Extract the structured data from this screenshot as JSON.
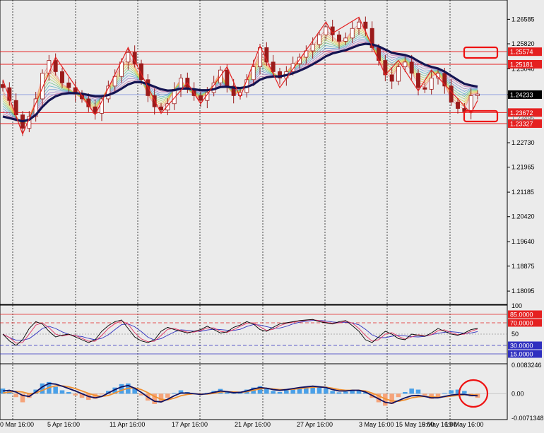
{
  "chart_data": {
    "type": "line",
    "main": {
      "y_ticks": [
        "1.26585",
        "1.25820",
        "1.25040",
        "1.24233",
        "1.22730",
        "1.21965",
        "1.21185",
        "1.20420",
        "1.19640",
        "1.18875",
        "1.18095"
      ],
      "ylim": [
        1.177,
        1.271
      ],
      "price_labels": [
        {
          "text": "1.25574",
          "value": 1.25574,
          "color": "#e52020"
        },
        {
          "text": "1.25181",
          "value": 1.25181,
          "color": "#e52020"
        },
        {
          "text": "1.24233",
          "value": 1.24233,
          "color": "#000000"
        },
        {
          "text": "1.23672",
          "value": 1.23672,
          "color": "#e52020"
        },
        {
          "text": "1.23327",
          "value": 1.23327,
          "color": "#e52020"
        }
      ],
      "hidden_tick": "1.23495",
      "levels": [
        1.25574,
        1.25181,
        1.23672,
        1.23327
      ],
      "current_price": 1.24233,
      "close_series": [
        1.2445,
        1.2405,
        1.236,
        1.2318,
        1.2355,
        1.241,
        1.249,
        1.253,
        1.2495,
        1.246,
        1.2445,
        1.2425,
        1.241,
        1.2385,
        1.2365,
        1.241,
        1.245,
        1.248,
        1.2525,
        1.2555,
        1.252,
        1.247,
        1.242,
        1.2385,
        1.2375,
        1.2395,
        1.244,
        1.2475,
        1.244,
        1.242,
        1.2405,
        1.243,
        1.246,
        1.25,
        1.245,
        1.242,
        1.243,
        1.247,
        1.251,
        1.257,
        1.2525,
        1.2495,
        1.2475,
        1.2495,
        1.252,
        1.254,
        1.256,
        1.258,
        1.261,
        1.2635,
        1.261,
        1.259,
        1.26,
        1.263,
        1.265,
        1.263,
        1.257,
        1.253,
        1.2485,
        1.2465,
        1.251,
        1.2525,
        1.249,
        1.2445,
        1.244,
        1.2475,
        1.249,
        1.245,
        1.24,
        1.238,
        1.237,
        1.242,
        1.2425
      ],
      "ema_series": [
        1.2355,
        1.235,
        1.2345,
        1.234,
        1.2345,
        1.236,
        1.2385,
        1.2405,
        1.2418,
        1.2425,
        1.2428,
        1.2428,
        1.2426,
        1.2422,
        1.2418,
        1.2418,
        1.2422,
        1.243,
        1.2442,
        1.2455,
        1.2462,
        1.2462,
        1.2456,
        1.2448,
        1.244,
        1.2436,
        1.2437,
        1.2442,
        1.2442,
        1.244,
        1.2437,
        1.2437,
        1.244,
        1.2447,
        1.2448,
        1.2445,
        1.2444,
        1.2447,
        1.2455,
        1.247,
        1.2477,
        1.248,
        1.248,
        1.2484,
        1.249,
        1.2498,
        1.2507,
        1.2518,
        1.253,
        1.2543,
        1.2552,
        1.2557,
        1.2562,
        1.257,
        1.2578,
        1.2582,
        1.258,
        1.2574,
        1.2564,
        1.2554,
        1.255,
        1.2547,
        1.254,
        1.2528,
        1.2517,
        1.251,
        1.2505,
        1.2495,
        1.2482,
        1.2469,
        1.2457,
        1.2452,
        1.2448
      ],
      "zigzag": [
        [
          0,
          1.247
        ],
        [
          3,
          1.23
        ],
        [
          8,
          1.254
        ],
        [
          14,
          1.236
        ],
        [
          19,
          1.257
        ],
        [
          24,
          1.2365
        ],
        [
          28,
          1.246
        ],
        [
          30,
          1.2395
        ],
        [
          34,
          1.251
        ],
        [
          36,
          1.2415
        ],
        [
          39,
          1.2575
        ],
        [
          42,
          1.2445
        ],
        [
          49,
          1.265
        ],
        [
          50,
          1.2615
        ],
        [
          54,
          1.2665
        ],
        [
          58,
          1.2485
        ],
        [
          60,
          1.253
        ],
        [
          63,
          1.2435
        ],
        [
          65,
          1.25
        ],
        [
          71,
          1.2365
        ],
        [
          72,
          1.2405
        ]
      ]
    },
    "rsi": {
      "y_ticks": [
        "100",
        "85.0000",
        "70.0000",
        "50",
        "30.0000",
        "15.0000"
      ],
      "levels": [
        85,
        70,
        50,
        30,
        15
      ],
      "ylim": [
        0,
        100
      ],
      "series": [
        50,
        38,
        30,
        40,
        60,
        72,
        68,
        55,
        45,
        48,
        50,
        45,
        40,
        35,
        40,
        55,
        65,
        72,
        75,
        60,
        45,
        38,
        35,
        40,
        55,
        62,
        58,
        55,
        52,
        55,
        58,
        64,
        58,
        52,
        54,
        62,
        66,
        72,
        68,
        58,
        55,
        62,
        68,
        70,
        72,
        74,
        75,
        76,
        72,
        70,
        68,
        72,
        74,
        65,
        55,
        40,
        35,
        45,
        55,
        50,
        42,
        40,
        50,
        48,
        46,
        52,
        60,
        55,
        50,
        48,
        52,
        58,
        60
      ]
    },
    "macd": {
      "y_ticks": [
        "0.0083246",
        "0.00",
        "-0.0071348"
      ],
      "ylim": [
        -0.0071348,
        0.0083246
      ],
      "histogram": [
        0.0015,
        0.0008,
        -0.001,
        -0.0025,
        -0.0012,
        0.0012,
        0.003,
        0.0034,
        0.002,
        0.001,
        0.0005,
        -0.0005,
        -0.0012,
        -0.0018,
        -0.0015,
        -0.0002,
        0.0008,
        0.0018,
        0.0028,
        0.003,
        0.0015,
        -0.0005,
        -0.002,
        -0.003,
        -0.0025,
        -0.0012,
        0.0002,
        0.001,
        0.0005,
        0.0,
        -0.0004,
        0.0002,
        0.0008,
        0.0014,
        0.0006,
        0.0,
        0.0004,
        0.0012,
        0.0018,
        0.0022,
        0.0016,
        0.0008,
        0.0005,
        0.001,
        0.0015,
        0.0018,
        0.002,
        0.0022,
        0.002,
        0.0015,
        0.0008,
        0.0004,
        0.0006,
        0.0008,
        0.001,
        0.0004,
        -0.0012,
        -0.0025,
        -0.0035,
        -0.003,
        -0.001,
        0.0005,
        0.0015,
        0.0012,
        -0.0005,
        -0.0015,
        -0.001,
        0.0002,
        0.001,
        0.0012,
        0.0008,
        -0.0008,
        -0.0012
      ],
      "main_line": [
        0.0008,
        0.001,
        0.0005,
        -0.0005,
        -0.0008,
        0.0005,
        0.002,
        0.003,
        0.0028,
        0.0022,
        0.0015,
        0.0008,
        0.0,
        -0.0008,
        -0.0012,
        -0.0008,
        0.0002,
        0.0012,
        0.002,
        0.0024,
        0.0016,
        0.0004,
        -0.001,
        -0.0022,
        -0.0024,
        -0.0016,
        -0.0006,
        0.0002,
        0.0002,
        0.0,
        -0.0002,
        0.0,
        0.0004,
        0.0008,
        0.0006,
        0.0003,
        0.0004,
        0.0008,
        0.0014,
        0.0018,
        0.0016,
        0.0012,
        0.001,
        0.0012,
        0.0015,
        0.0018,
        0.002,
        0.0022,
        0.002,
        0.0018,
        0.0012,
        0.0008,
        0.0008,
        0.001,
        0.001,
        0.0005,
        -0.0005,
        -0.0015,
        -0.0025,
        -0.0028,
        -0.002,
        -0.0012,
        -0.0006,
        -0.0005,
        -0.0008,
        -0.0012,
        -0.0012,
        -0.0008,
        -0.0004,
        -0.0002,
        -0.0002,
        -0.0005,
        -0.0006
      ],
      "signal_line": [
        0.0002,
        0.0005,
        0.0007,
        0.0005,
        0.0,
        0.0002,
        0.001,
        0.0018,
        0.0023,
        0.0023,
        0.002,
        0.0015,
        0.0008,
        0.0001,
        -0.0005,
        -0.0008,
        -0.0005,
        0.0002,
        0.001,
        0.0016,
        0.0017,
        0.0012,
        0.0003,
        -0.0008,
        -0.0016,
        -0.0018,
        -0.0013,
        -0.0006,
        -0.0002,
        0.0,
        -0.0001,
        -0.0001,
        0.0001,
        0.0005,
        0.0006,
        0.0005,
        0.0004,
        0.0006,
        0.001,
        0.0014,
        0.0016,
        0.0014,
        0.0012,
        0.0012,
        0.0013,
        0.0015,
        0.0017,
        0.0019,
        0.002,
        0.0019,
        0.0016,
        0.0012,
        0.001,
        0.001,
        0.001,
        0.0008,
        0.0002,
        -0.0006,
        -0.0015,
        -0.0021,
        -0.0022,
        -0.0018,
        -0.0012,
        -0.0009,
        -0.0008,
        -0.0009,
        -0.001,
        -0.0009,
        -0.0007,
        -0.0005,
        -0.0003,
        -0.0003,
        -0.0004
      ]
    },
    "x_labels": [
      "0 Mar 16:00",
      "5 Apr 16:00",
      "11 Apr 16:00",
      "17 Apr 16:00",
      "21 Apr 16:00",
      "27 Apr 16:00",
      "3 May 16:00",
      "9 May 16:00",
      "15 May 16:00",
      "19 May 16:00"
    ]
  },
  "colors": {
    "background": "#ebebeb",
    "candle": "#9b1b1b",
    "ema_thick": "#141452",
    "zigzag": "#e52020",
    "support_resistance": "#e52020",
    "current_price_line": "#8899dd",
    "histogram_pos": "#4aa0e8",
    "histogram_neg": "#f5a37a",
    "macd_main": "#101060",
    "macd_signal": "#f09030",
    "rsi_fast": "#000000",
    "rsi_mid": "#e03060",
    "rsi_slow": "#3030c0",
    "annotation": "#ee1111"
  }
}
